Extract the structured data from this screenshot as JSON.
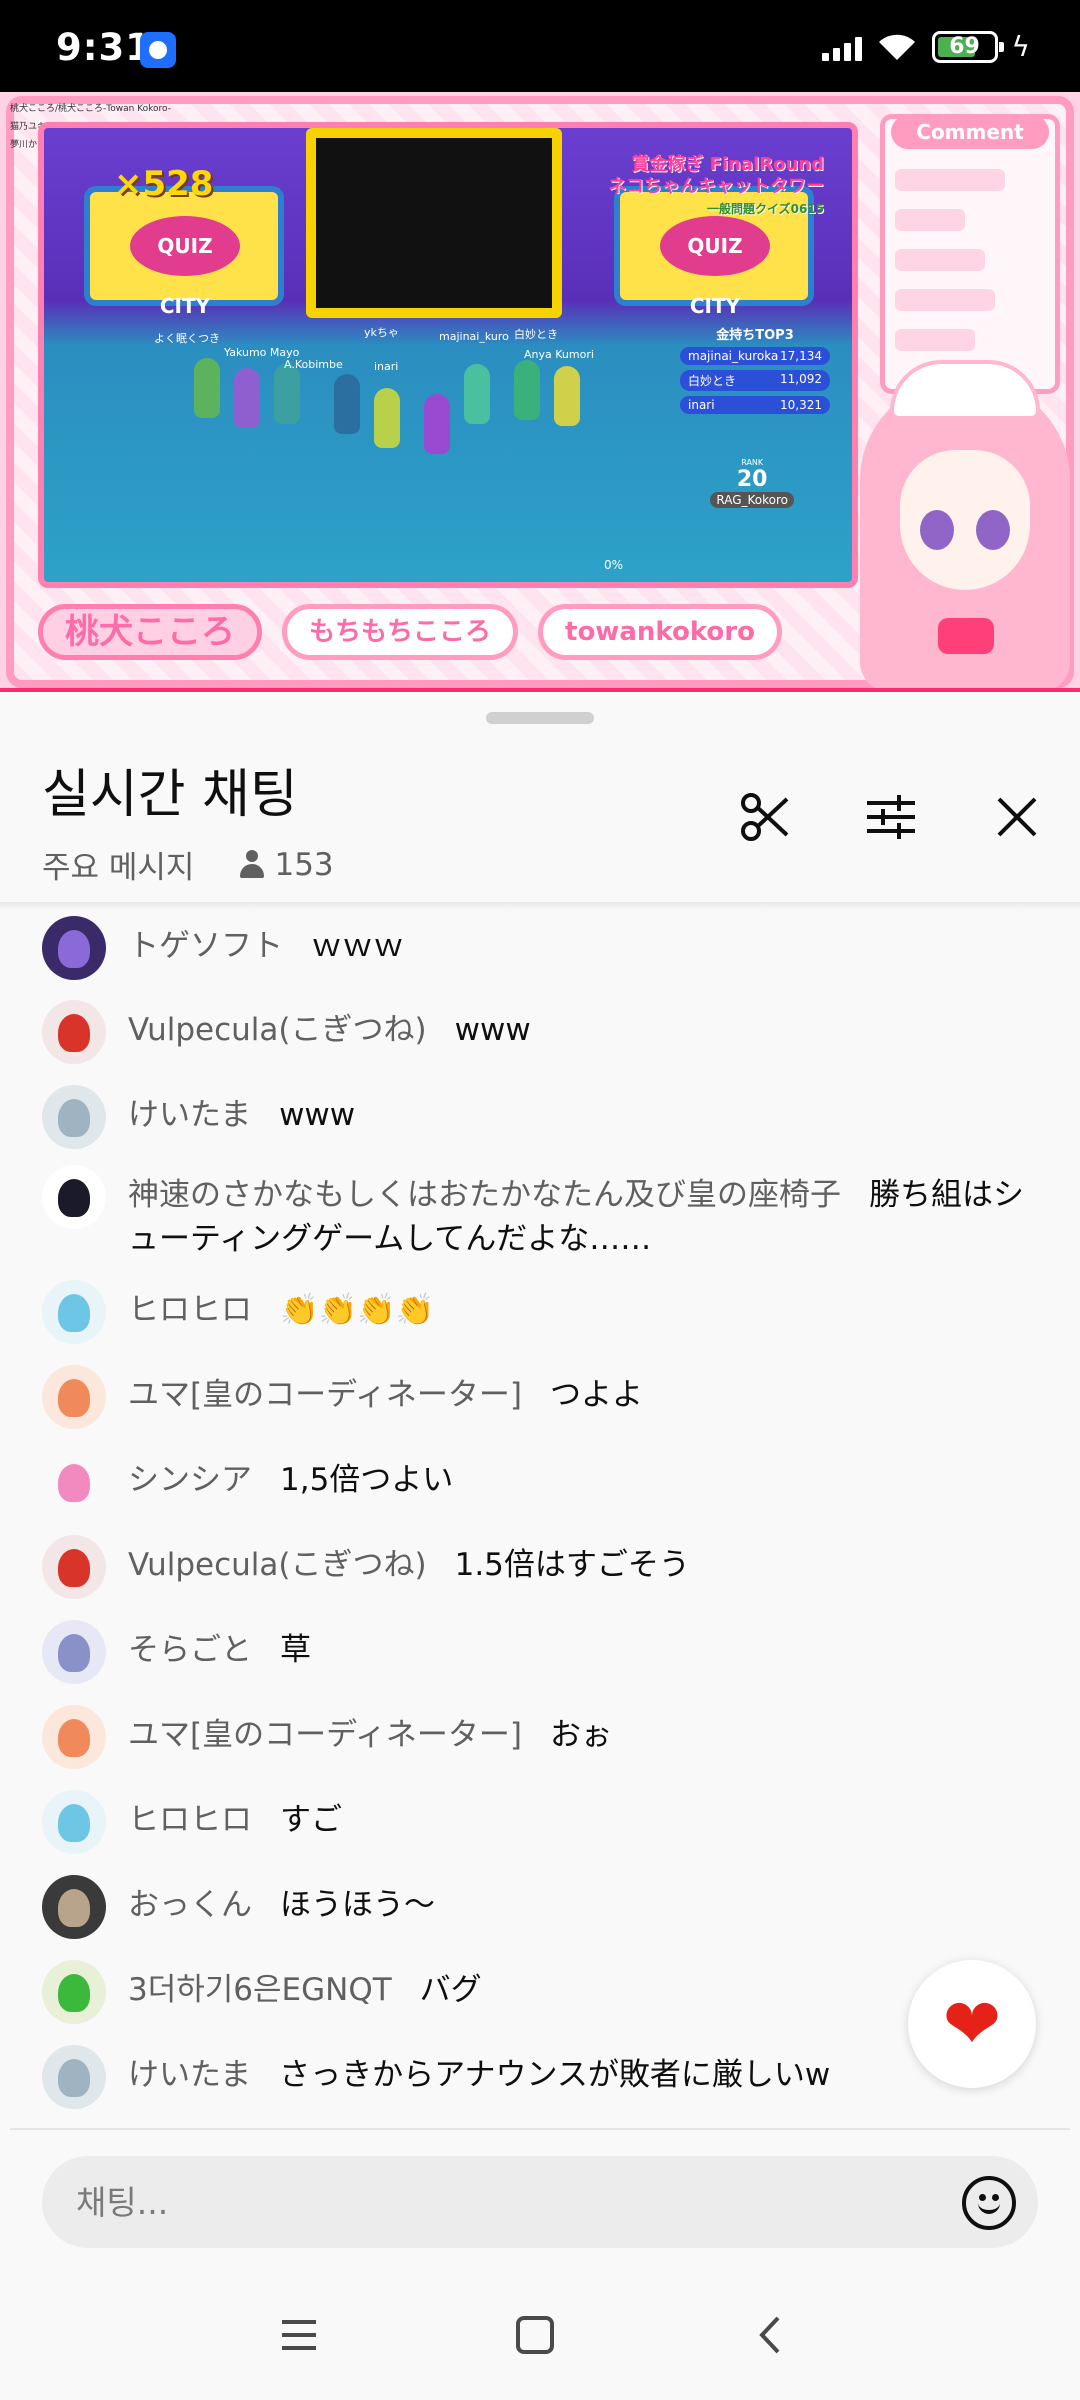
{
  "status_bar": {
    "time": "9:31",
    "battery": "69",
    "battery_level": 0.69,
    "app_icon": "messenger-icon"
  },
  "video": {
    "overlay_name_tags": [
      "桃犬こころ/桃犬こころ-Towan Kokoro-",
      "猫乃ユキノ",
      "夢川かなう"
    ],
    "coin_counter": "×528",
    "round_title_line1": "賞金稼ぎ FinalRound",
    "round_title_line2": "ネコちゃんキャットタワー",
    "round_title_line3": "一般問題クイズ0615",
    "board_logo": "QUIZ CITY",
    "top3_title": "金持ちTOP3",
    "top3": [
      {
        "name": "majinai_kuroka",
        "score": "17,134"
      },
      {
        "name": "白妙とき",
        "score": "11,092"
      },
      {
        "name": "inari",
        "score": "10,321"
      }
    ],
    "rank_label": "RANK",
    "rank_value": "20",
    "rank_player": "RAG_Kokoro",
    "progress_text": "0%",
    "player_tags": [
      "よく眠くつき",
      "Yakumo Mayo",
      "A.Kobimbe",
      "ykちゃ",
      "majinai_kuro",
      "白妙とき",
      "Anya Kumori",
      "inari"
    ],
    "comment_panel_title": "Comment",
    "banner_logo": "桃犬こころ",
    "banner_tag1": "もちもちこころ",
    "banner_tag2": "towankokoro"
  },
  "sheet": {
    "title": "실시간 채팅",
    "filter_label": "주요 메시지",
    "viewer_count": "153"
  },
  "messages": [
    {
      "author": "トゲソフト",
      "text": "ｗｗｗ",
      "avatar_bg": "#3a2a6a",
      "avatar_fg": "#8a6ad8"
    },
    {
      "author": "Vulpecula(こぎつね)",
      "text": "www",
      "avatar_bg": "#f3e6e6",
      "avatar_fg": "#d8342a"
    },
    {
      "author": "けいたま",
      "text": "www",
      "avatar_bg": "#dfe7ea",
      "avatar_fg": "#9fb3c0"
    },
    {
      "author": "神速のさかなもしくはおたかなたん及び皇の座椅子",
      "text": "勝ち組はシューティングゲームしてんだよな……",
      "avatar_bg": "#ffffff",
      "avatar_fg": "#1a1a2a"
    },
    {
      "author": "ヒロヒロ",
      "text": "👏👏👏👏",
      "avatar_bg": "#e8f4f8",
      "avatar_fg": "#6ec6e6"
    },
    {
      "author": "ユマ[皇のコーディネーター]",
      "text": "つよよ",
      "avatar_bg": "#fbe7dc",
      "avatar_fg": "#f08a5a"
    },
    {
      "author": "シンシア",
      "text": "1,5倍つよい",
      "avatar_bg": "#f9f9f9",
      "avatar_fg": "#f28ac0"
    },
    {
      "author": "Vulpecula(こぎつね)",
      "text": "1.5倍はすごそう",
      "avatar_bg": "#f3e6e6",
      "avatar_fg": "#d8342a"
    },
    {
      "author": "そらごと",
      "text": "草",
      "avatar_bg": "#e6e8f5",
      "avatar_fg": "#8a90c8"
    },
    {
      "author": "ユマ[皇のコーディネーター]",
      "text": "おぉ",
      "avatar_bg": "#fbe7dc",
      "avatar_fg": "#f08a5a"
    },
    {
      "author": "ヒロヒロ",
      "text": "すご",
      "avatar_bg": "#e8f4f8",
      "avatar_fg": "#6ec6e6"
    },
    {
      "author": "おっくん",
      "text": "ほうほう～",
      "avatar_bg": "#3a3a3a",
      "avatar_fg": "#b8a48a"
    },
    {
      "author": "3더하기6은EGNQT",
      "text": "バグ",
      "avatar_bg": "#e8f0d8",
      "avatar_fg": "#3cb83c"
    },
    {
      "author": "けいたま",
      "text": "さっきからアナウンスが敗者に厳しいw",
      "avatar_bg": "#dfe7ea",
      "avatar_fg": "#9fb3c0"
    }
  ],
  "input": {
    "placeholder": "채팅..."
  },
  "icons": {
    "clip": "scissors-icon",
    "filter": "sliders-icon",
    "close": "close-icon",
    "like": "heart-icon",
    "emoji": "smiley-icon",
    "nav_menu": "menu-icon",
    "nav_home": "square-home-icon",
    "nav_back": "back-chevron-icon"
  },
  "colors": {
    "heart": "#e62117",
    "text_primary": "#0f0f0f",
    "text_secondary": "#606060",
    "stream_pink": "#ff9cc0"
  }
}
